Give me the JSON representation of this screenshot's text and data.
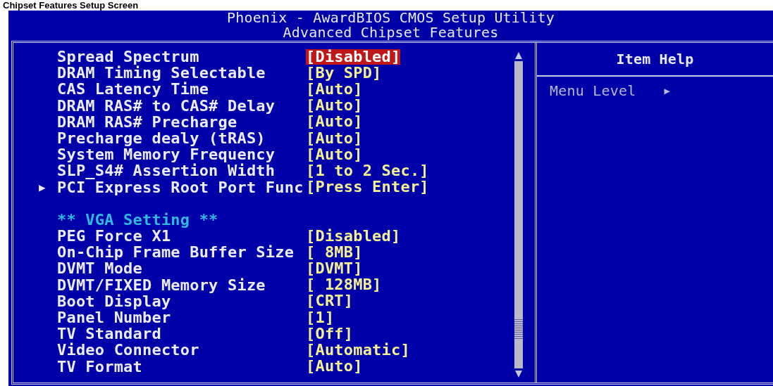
{
  "page_heading": "Chipset Features Setup Screen",
  "header": {
    "title": "Phoenix - AwardBIOS CMOS Setup Utility",
    "subtitle": "Advanced Chipset Features"
  },
  "items": [
    {
      "kind": "setting",
      "label": "Spread Spectrum",
      "value": "[Disabled]",
      "selected": true
    },
    {
      "kind": "setting",
      "label": "DRAM Timing Selectable",
      "value": "[By SPD]",
      "selected": false
    },
    {
      "kind": "setting",
      "label": "CAS Latency Time",
      "value": "[Auto]",
      "selected": false
    },
    {
      "kind": "setting",
      "label": "DRAM RAS# to CAS# Delay",
      "value": "[Auto]",
      "selected": false
    },
    {
      "kind": "setting",
      "label": "DRAM RAS# Precharge",
      "value": "[Auto]",
      "selected": false
    },
    {
      "kind": "setting",
      "label": "Precharge dealy (tRAS)",
      "value": "[Auto]",
      "selected": false
    },
    {
      "kind": "setting",
      "label": "System Memory Frequency",
      "value": "[Auto]",
      "selected": false
    },
    {
      "kind": "setting",
      "label": "SLP_S4# Assertion Width",
      "value": "[1 to 2 Sec.]",
      "selected": false
    },
    {
      "kind": "submenu",
      "marker": "▶",
      "label": "PCI Express Root Port Func",
      "value": "[Press Enter]",
      "selected": false
    },
    {
      "kind": "blank"
    },
    {
      "kind": "heading",
      "label": "** VGA Setting **"
    },
    {
      "kind": "setting",
      "label": "PEG Force X1",
      "value": "[Disabled]",
      "selected": false
    },
    {
      "kind": "setting",
      "label": "On-Chip Frame Buffer Size",
      "value": "[ 8MB]",
      "selected": false
    },
    {
      "kind": "setting",
      "label": "DVMT Mode",
      "value": "[DVMT]",
      "selected": false
    },
    {
      "kind": "setting",
      "label": "DVMT/FIXED Memory Size",
      "value": "[ 128MB]",
      "selected": false
    },
    {
      "kind": "setting",
      "label": "Boot Display",
      "value": "[CRT]",
      "selected": false
    },
    {
      "kind": "setting",
      "label": "Panel Number",
      "value": "[1]",
      "selected": false
    },
    {
      "kind": "setting",
      "label": "TV Standard",
      "value": "[Off]",
      "selected": false
    },
    {
      "kind": "setting",
      "label": "Video Connector",
      "value": "[Automatic]",
      "selected": false
    },
    {
      "kind": "setting",
      "label": "TV Format",
      "value": "[Auto]",
      "selected": false
    }
  ],
  "help": {
    "title": "Item Help",
    "menu_level_label": "Menu Level",
    "menu_level_marker": "▶"
  }
}
